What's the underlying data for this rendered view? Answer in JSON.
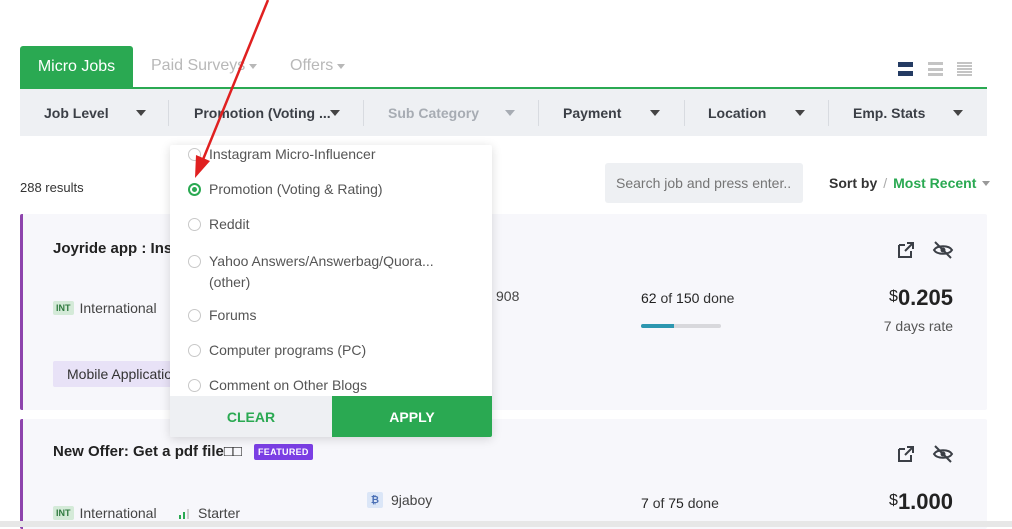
{
  "tabs": {
    "micro_jobs": "Micro Jobs",
    "paid_surveys": "Paid Surveys",
    "offers": "Offers"
  },
  "view_icons": [
    "grid-view-icon",
    "list-view-icon",
    "compact-list-icon"
  ],
  "filters": {
    "job_level": "Job Level",
    "promotion": "Promotion (Voting ...",
    "sub_category": "Sub Category",
    "payment": "Payment",
    "location": "Location",
    "emp_stats": "Emp. Stats"
  },
  "results_count": "288 results",
  "search": {
    "placeholder": "Search job and press enter..."
  },
  "sort": {
    "label": "Sort by",
    "separator": "/",
    "value": "Most Recent"
  },
  "dropdown": {
    "options": [
      {
        "label": "Instagram Micro-Influencer",
        "selected": false
      },
      {
        "label": "Promotion (Voting & Rating)",
        "selected": true
      },
      {
        "label": "Reddit",
        "selected": false
      },
      {
        "label": "Yahoo Answers/Answerbag/Quora...",
        "label2": "(other)",
        "selected": false
      },
      {
        "label": "Forums",
        "selected": false
      },
      {
        "label": "Computer programs (PC)",
        "selected": false
      },
      {
        "label": "Comment on Other Blogs",
        "selected": false
      }
    ],
    "clear": "CLEAR",
    "apply": "APPLY"
  },
  "jobs": [
    {
      "title": "Joyride app : Inst",
      "badge": "INT",
      "location": "International",
      "employer_id_fragment": "908",
      "done_count": "62",
      "of_label": "of",
      "total": "150",
      "done_label": "done",
      "progress": 0.41,
      "currency": "$",
      "price": "0.205",
      "rate": "7 days rate",
      "tag": "Mobile Applicatio"
    },
    {
      "title": "New Offer: Get a pdf file",
      "title_suffix": "□□",
      "featured": "FEATURED",
      "badge": "INT",
      "location": "International",
      "level": "Starter",
      "employer": "9jaboy",
      "done_count": "7",
      "of_label": "of",
      "total": "75",
      "done_label": "done",
      "currency": "$",
      "price": "1.000"
    }
  ],
  "colors": {
    "brand_green": "#2aa952",
    "card_accent": "#8e44ad",
    "featured": "#7b3fe4",
    "annotation_arrow": "#e02020"
  }
}
